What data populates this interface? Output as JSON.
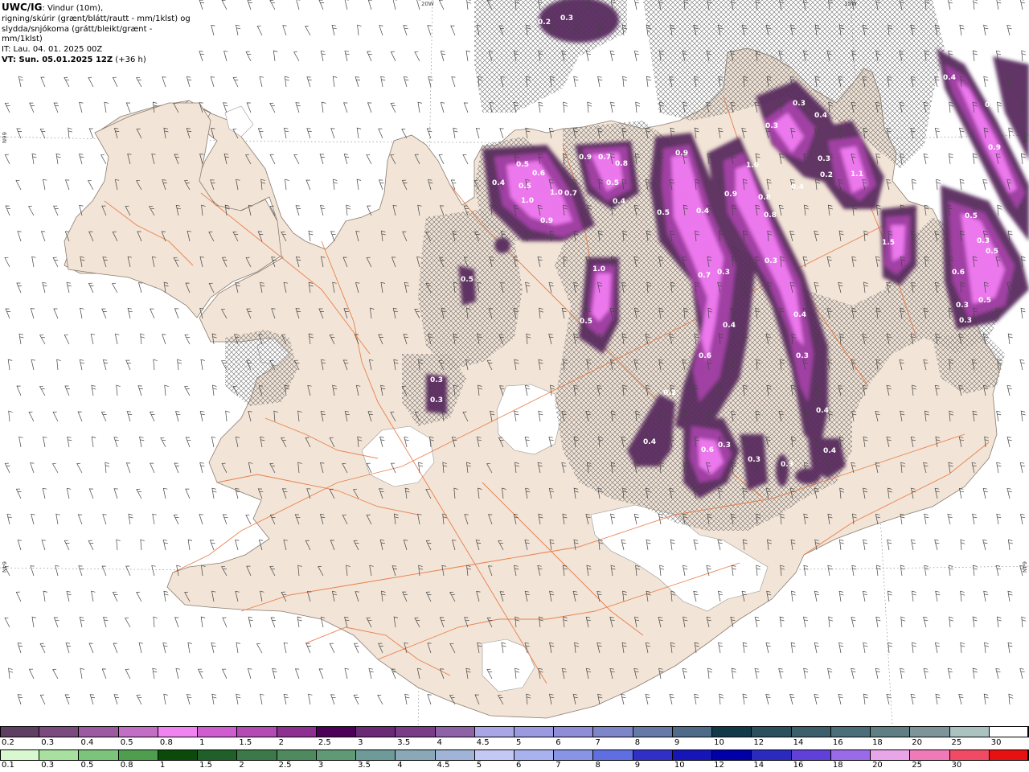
{
  "info": {
    "model": "UWC/IG",
    "line1_rest": ": Vindur (10m),",
    "line2": "rigning/skúrir (grænt/blátt/rautt - mm/1klst) og",
    "line3": "slydda/snjókoma (grátt/bleikt/grænt - mm/1klst)",
    "it": "IT: Lau. 04. 01. 2025 00Z",
    "vt_bold": "VT: Sun. 05.01.2025 12Z",
    "vt_rest": " (+36 h)"
  },
  "coords": {
    "top_left": "20W",
    "top_right": "15W",
    "left_upper": "66N",
    "left_lower": "64N",
    "right_upper": "66N",
    "right_lower": "64N"
  },
  "colors": {
    "land": "#f2e4d6",
    "sea": "#ffffff",
    "roads": "#e8763f",
    "precip_dark": "#5a2d5e",
    "precip_mid": "#a542a8",
    "precip_light": "#f07af0"
  },
  "precip_labels": [
    {
      "t": "0.3"
    },
    {
      "t": "0.2"
    },
    {
      "t": "0.5"
    },
    {
      "t": "0.6"
    },
    {
      "t": "0.4"
    },
    {
      "t": "0.5"
    },
    {
      "t": "1.0"
    },
    {
      "t": "0.9"
    },
    {
      "t": "1.0"
    },
    {
      "t": "0.7"
    },
    {
      "t": "0.9"
    },
    {
      "t": "0.7"
    },
    {
      "t": "0.8"
    },
    {
      "t": "0.5"
    },
    {
      "t": "0.4"
    },
    {
      "t": "0.9"
    },
    {
      "t": "0.9"
    },
    {
      "t": "1.0"
    },
    {
      "t": "0.8"
    },
    {
      "t": "0.8"
    },
    {
      "t": "0.3"
    },
    {
      "t": "0.3"
    },
    {
      "t": "0.4"
    },
    {
      "t": "0.3"
    },
    {
      "t": "0.2"
    },
    {
      "t": "1.1"
    },
    {
      "t": "0.4"
    },
    {
      "t": "1.5"
    },
    {
      "t": "0.4"
    },
    {
      "t": "0.4"
    },
    {
      "t": "0.9"
    },
    {
      "t": "0.5"
    },
    {
      "t": "0.3"
    },
    {
      "t": "0.5"
    },
    {
      "t": "0.6"
    },
    {
      "t": "0.3"
    },
    {
      "t": "0.5"
    },
    {
      "t": "0.3"
    },
    {
      "t": "0.5"
    },
    {
      "t": "1.0"
    },
    {
      "t": "0.5"
    },
    {
      "t": "0.4"
    },
    {
      "t": "0.5"
    },
    {
      "t": "0.7"
    },
    {
      "t": "0.3"
    },
    {
      "t": "0.4"
    },
    {
      "t": "0.3"
    },
    {
      "t": "0.6"
    },
    {
      "t": "0.3"
    },
    {
      "t": "0.4"
    },
    {
      "t": "0.6"
    },
    {
      "t": "0.3"
    },
    {
      "t": "0.2"
    },
    {
      "t": "0.4"
    },
    {
      "t": "0.4"
    },
    {
      "t": "0.3"
    },
    {
      "t": "0.3"
    },
    {
      "t": "0.3"
    },
    {
      "t": "0.4"
    },
    {
      "t": "0.3"
    }
  ],
  "legend_snow": {
    "colors": [
      "#5e3e63",
      "#7b4a7f",
      "#9c5aa0",
      "#c26ec4",
      "#f083f0",
      "#cf5dcf",
      "#b44ab4",
      "#8e3091",
      "#4d0057",
      "#6a2a76",
      "#7a3c86",
      "#8f62a8",
      "#a9a6e6",
      "#9b9ae0",
      "#8f8cd8",
      "#7c86c8",
      "#667aa8",
      "#4f6b8a",
      "#103a4a",
      "#2a4f5e",
      "#3c5f6c",
      "#4a6f78",
      "#5f7f84",
      "#7d9598",
      "#aac2c0",
      "#ffffff"
    ],
    "labels": [
      "0.2",
      "0.3",
      "0.4",
      "0.5",
      "0.8",
      "1",
      "1.5",
      "2",
      "2.5",
      "3",
      "3.5",
      "4",
      "4.5",
      "5",
      "6",
      "7",
      "8",
      "9",
      "10",
      "12",
      "14",
      "16",
      "18",
      "20",
      "25",
      "30"
    ]
  },
  "legend_rain": {
    "colors": [
      "#d8f8d0",
      "#a8e0a0",
      "#7cc47c",
      "#4e9e4e",
      "#0c4a0c",
      "#1f5f2a",
      "#3b7a48",
      "#4e8a5e",
      "#5f9a74",
      "#6e9a98",
      "#8aa8b8",
      "#a0b4d8",
      "#c4c8f4",
      "#a8b2ee",
      "#8894e6",
      "#5f6ee0",
      "#3030c8",
      "#1515b8",
      "#0000a8",
      "#2a2ac0",
      "#6040d8",
      "#9a6ae8",
      "#e8a6e8",
      "#f07ab8",
      "#f04a64",
      "#e81010"
    ],
    "labels": [
      "0.1",
      "0.3",
      "0.5",
      "0.8",
      "1",
      "1.5",
      "2",
      "2.5",
      "3",
      "3.5",
      "4",
      "4.5",
      "5",
      "6",
      "7",
      "8",
      "9",
      "10",
      "12",
      "14",
      "16",
      "18",
      "20",
      "25",
      "30"
    ]
  }
}
